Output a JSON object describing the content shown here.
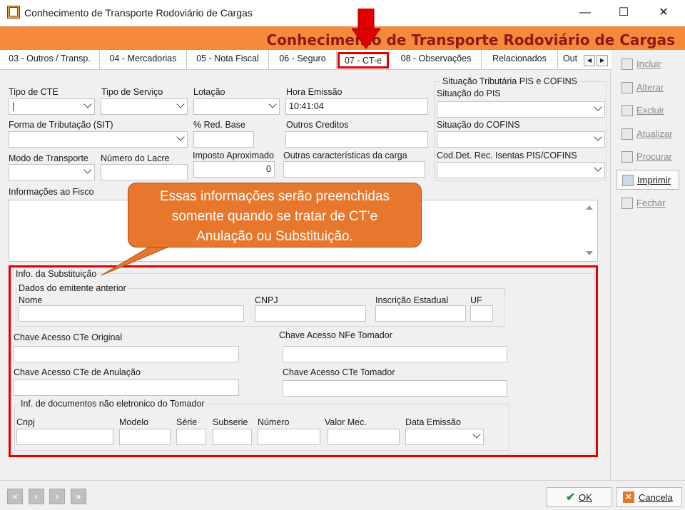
{
  "window": {
    "title": "Conhecimento de Transporte Rodoviário de Cargas",
    "minimize": "—",
    "maximize": "☐",
    "close": "✕"
  },
  "banner": {
    "title": "Conhecimento de Transporte Rodoviário de Cargas"
  },
  "tabs": [
    {
      "label": "03 - Outros / Transp."
    },
    {
      "label": "04 - Mercadorias"
    },
    {
      "label": "05 - Nota Fiscal"
    },
    {
      "label": "06 - Seguro"
    },
    {
      "label": "07 - CT-e",
      "active": true
    },
    {
      "label": "08 - Observações"
    },
    {
      "label": "Relacionados"
    },
    {
      "label": "Out"
    }
  ],
  "form": {
    "tipo_cte": {
      "label": "Tipo de CTE",
      "value": "|"
    },
    "tipo_servico": {
      "label": "Tipo de Serviço",
      "value": ""
    },
    "lotacao": {
      "label": "Lotação",
      "value": ""
    },
    "hora_emissao": {
      "label": "Hora Emissão",
      "value": "10:41:04"
    },
    "forma_tributacao": {
      "label": "Forma de Tributação (SIT)",
      "value": ""
    },
    "red_base": {
      "label": "% Red. Base",
      "value": ""
    },
    "outros_creditos": {
      "label": "Outros Creditos",
      "value": ""
    },
    "modo_transporte": {
      "label": "Modo de Transporte",
      "value": ""
    },
    "numero_lacre": {
      "label": "Número do Lacre",
      "value": ""
    },
    "imposto_aproximado": {
      "label": "Imposto Aproximado",
      "value": "0"
    },
    "outras_caracteristicas": {
      "label": "Outras características da carga",
      "value": ""
    },
    "informacoes_fisco": {
      "label": "Informações ao Fisco",
      "value": ""
    }
  },
  "pis_cofins": {
    "group_title": "Situação Tributária PIS e COFINS",
    "situacao_pis": "Situação do PIS",
    "situacao_cofins": "Situação do COFINS",
    "cod_det": "Cod.Det. Rec. Isentas PIS/COFINS"
  },
  "substituicao": {
    "group_title": "Info. da Substituição",
    "emitente_title": "Dados do emitente anterior",
    "nome": "Nome",
    "cnpj": "CNPJ",
    "inscricao": "Inscrição Estadual",
    "uf": "UF",
    "chave_original": "Chave Acesso CTe Original",
    "chave_nfe_tomador": "Chave Acesso NFe Tomador",
    "chave_anulacao": "Chave Acesso CTe de Anulação",
    "chave_cte_tomador": "Chave Acesso CTe Tomador",
    "docs_title": "Inf. de documentos não eletronico do Tomador",
    "cnpj_doc": "Cnpj",
    "modelo": "Modelo",
    "serie": "Série",
    "subserie": "Subserie",
    "numero": "Número",
    "valor_mec": "Valor Mec.",
    "data_emissao": "Data Emissão"
  },
  "callout": {
    "line1": "Essas informações serão preenchidas",
    "line2": "somente quando se tratar de CT’e",
    "line3": "Anulação ou Substituição."
  },
  "sidebar": [
    {
      "label": "Incluir",
      "enabled": false,
      "icon": "document-icon"
    },
    {
      "label": "Alterar",
      "enabled": false,
      "icon": "edit-icon"
    },
    {
      "label": "Excluir",
      "enabled": false,
      "icon": "delete-icon"
    },
    {
      "label": "Atualizar",
      "enabled": false,
      "icon": "refresh-icon"
    },
    {
      "label": "Procurar",
      "enabled": false,
      "icon": "binoculars-icon"
    },
    {
      "label": "Imprimir",
      "enabled": true,
      "icon": "printer-icon"
    },
    {
      "label": "Fechar",
      "enabled": false,
      "icon": "close-folder-icon"
    }
  ],
  "footer": {
    "ok": "OK",
    "cancel": "Cancela",
    "nav": [
      "«",
      "‹",
      "›",
      "»"
    ]
  },
  "colors": {
    "banner": "#f58a3c",
    "banner_text": "#8b1a1a",
    "highlight": "#e00000",
    "callout": "#e8772e"
  }
}
